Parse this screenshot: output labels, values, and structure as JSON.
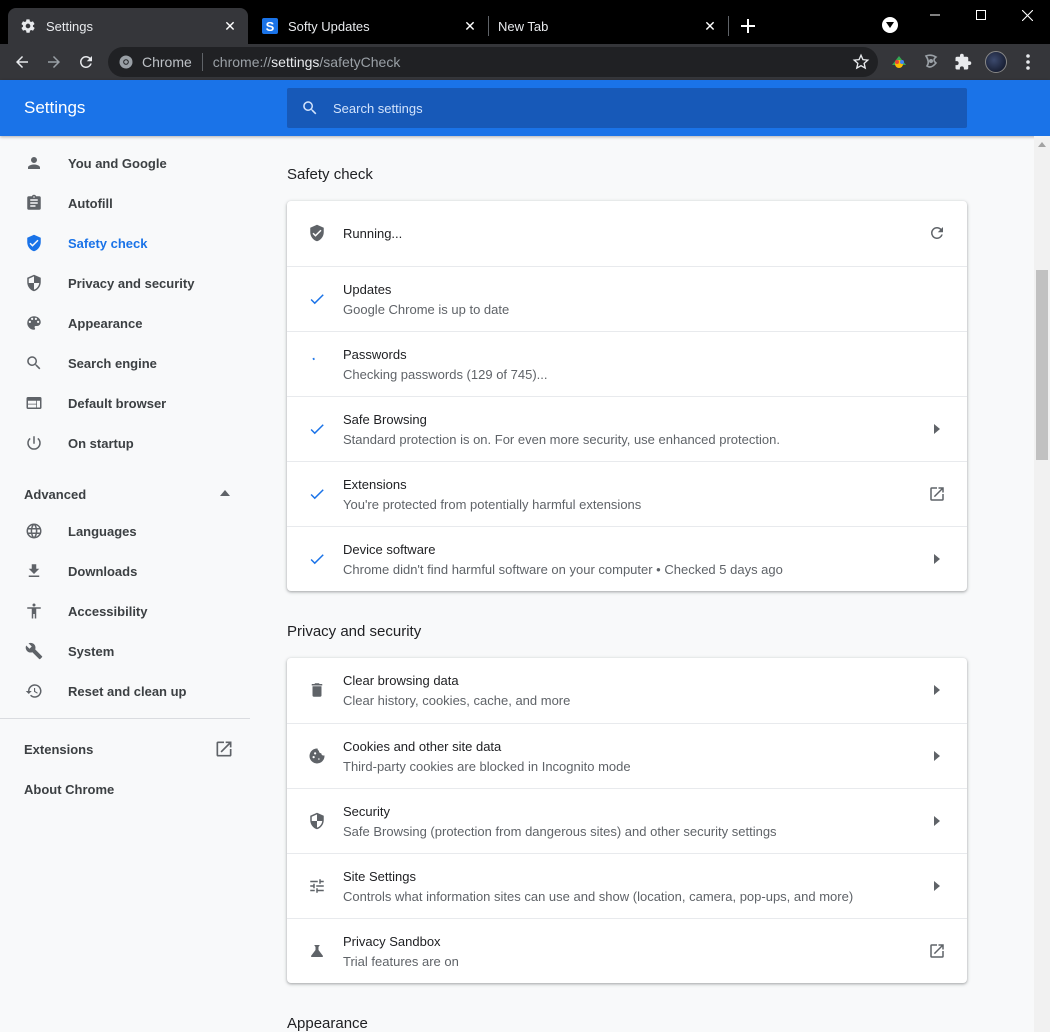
{
  "browser": {
    "tabs": [
      {
        "label": "Settings",
        "icon": "gear-icon"
      },
      {
        "label": "Softy Updates",
        "icon": "softy-s-icon"
      },
      {
        "label": "New Tab",
        "icon": ""
      }
    ],
    "tab_close_glyph": "✕",
    "omnibox": {
      "chip": "Chrome",
      "url_scheme": "chrome://",
      "url_host": "settings",
      "url_path": "/safetyCheck"
    }
  },
  "header": {
    "title": "Settings",
    "search_placeholder": "Search settings"
  },
  "sidebar": {
    "items": [
      {
        "label": "You and Google",
        "icon": "person-icon"
      },
      {
        "label": "Autofill",
        "icon": "clipboard-icon"
      },
      {
        "label": "Safety check",
        "icon": "shield-check-icon",
        "active": true
      },
      {
        "label": "Privacy and security",
        "icon": "shield-icon"
      },
      {
        "label": "Appearance",
        "icon": "palette-icon"
      },
      {
        "label": "Search engine",
        "icon": "search-icon"
      },
      {
        "label": "Default browser",
        "icon": "browser-icon"
      },
      {
        "label": "On startup",
        "icon": "power-icon"
      }
    ],
    "advanced_label": "Advanced",
    "advanced_items": [
      {
        "label": "Languages",
        "icon": "globe-icon"
      },
      {
        "label": "Downloads",
        "icon": "download-icon"
      },
      {
        "label": "Accessibility",
        "icon": "accessibility-icon"
      },
      {
        "label": "System",
        "icon": "wrench-icon"
      },
      {
        "label": "Reset and clean up",
        "icon": "history-icon"
      }
    ],
    "extensions_label": "Extensions",
    "about_label": "About Chrome"
  },
  "safety_check": {
    "title": "Safety check",
    "status": "Running...",
    "rows": [
      {
        "title": "Updates",
        "subtitle": "Google Chrome is up to date",
        "state": "ok"
      },
      {
        "title": "Passwords",
        "subtitle": "Checking passwords (129 of 745)...",
        "state": "running"
      },
      {
        "title": "Safe Browsing",
        "subtitle": "Standard protection is on. For even more security, use enhanced protection.",
        "state": "ok",
        "action": "arrow"
      },
      {
        "title": "Extensions",
        "subtitle": "You're protected from potentially harmful extensions",
        "state": "ok",
        "action": "external"
      },
      {
        "title": "Device software",
        "subtitle": "Chrome didn't find harmful software on your computer • Checked 5 days ago",
        "state": "ok",
        "action": "arrow"
      }
    ]
  },
  "privacy": {
    "title": "Privacy and security",
    "rows": [
      {
        "title": "Clear browsing data",
        "subtitle": "Clear history, cookies, cache, and more",
        "icon": "trash-icon",
        "action": "arrow"
      },
      {
        "title": "Cookies and other site data",
        "subtitle": "Third-party cookies are blocked in Incognito mode",
        "icon": "cookie-icon",
        "action": "arrow"
      },
      {
        "title": "Security",
        "subtitle": "Safe Browsing (protection from dangerous sites) and other security settings",
        "icon": "shield-icon",
        "action": "arrow"
      },
      {
        "title": "Site Settings",
        "subtitle": "Controls what information sites can use and show (location, camera, pop-ups, and more)",
        "icon": "tune-icon",
        "action": "arrow"
      },
      {
        "title": "Privacy Sandbox",
        "subtitle": "Trial features are on",
        "icon": "flask-icon",
        "action": "external"
      }
    ]
  },
  "appearance": {
    "title": "Appearance"
  },
  "colors": {
    "accent": "#1a73e8",
    "header_bg": "#1a73e8",
    "tab_active_bg": "#35363a",
    "page_bg": "#f8f9fa"
  }
}
